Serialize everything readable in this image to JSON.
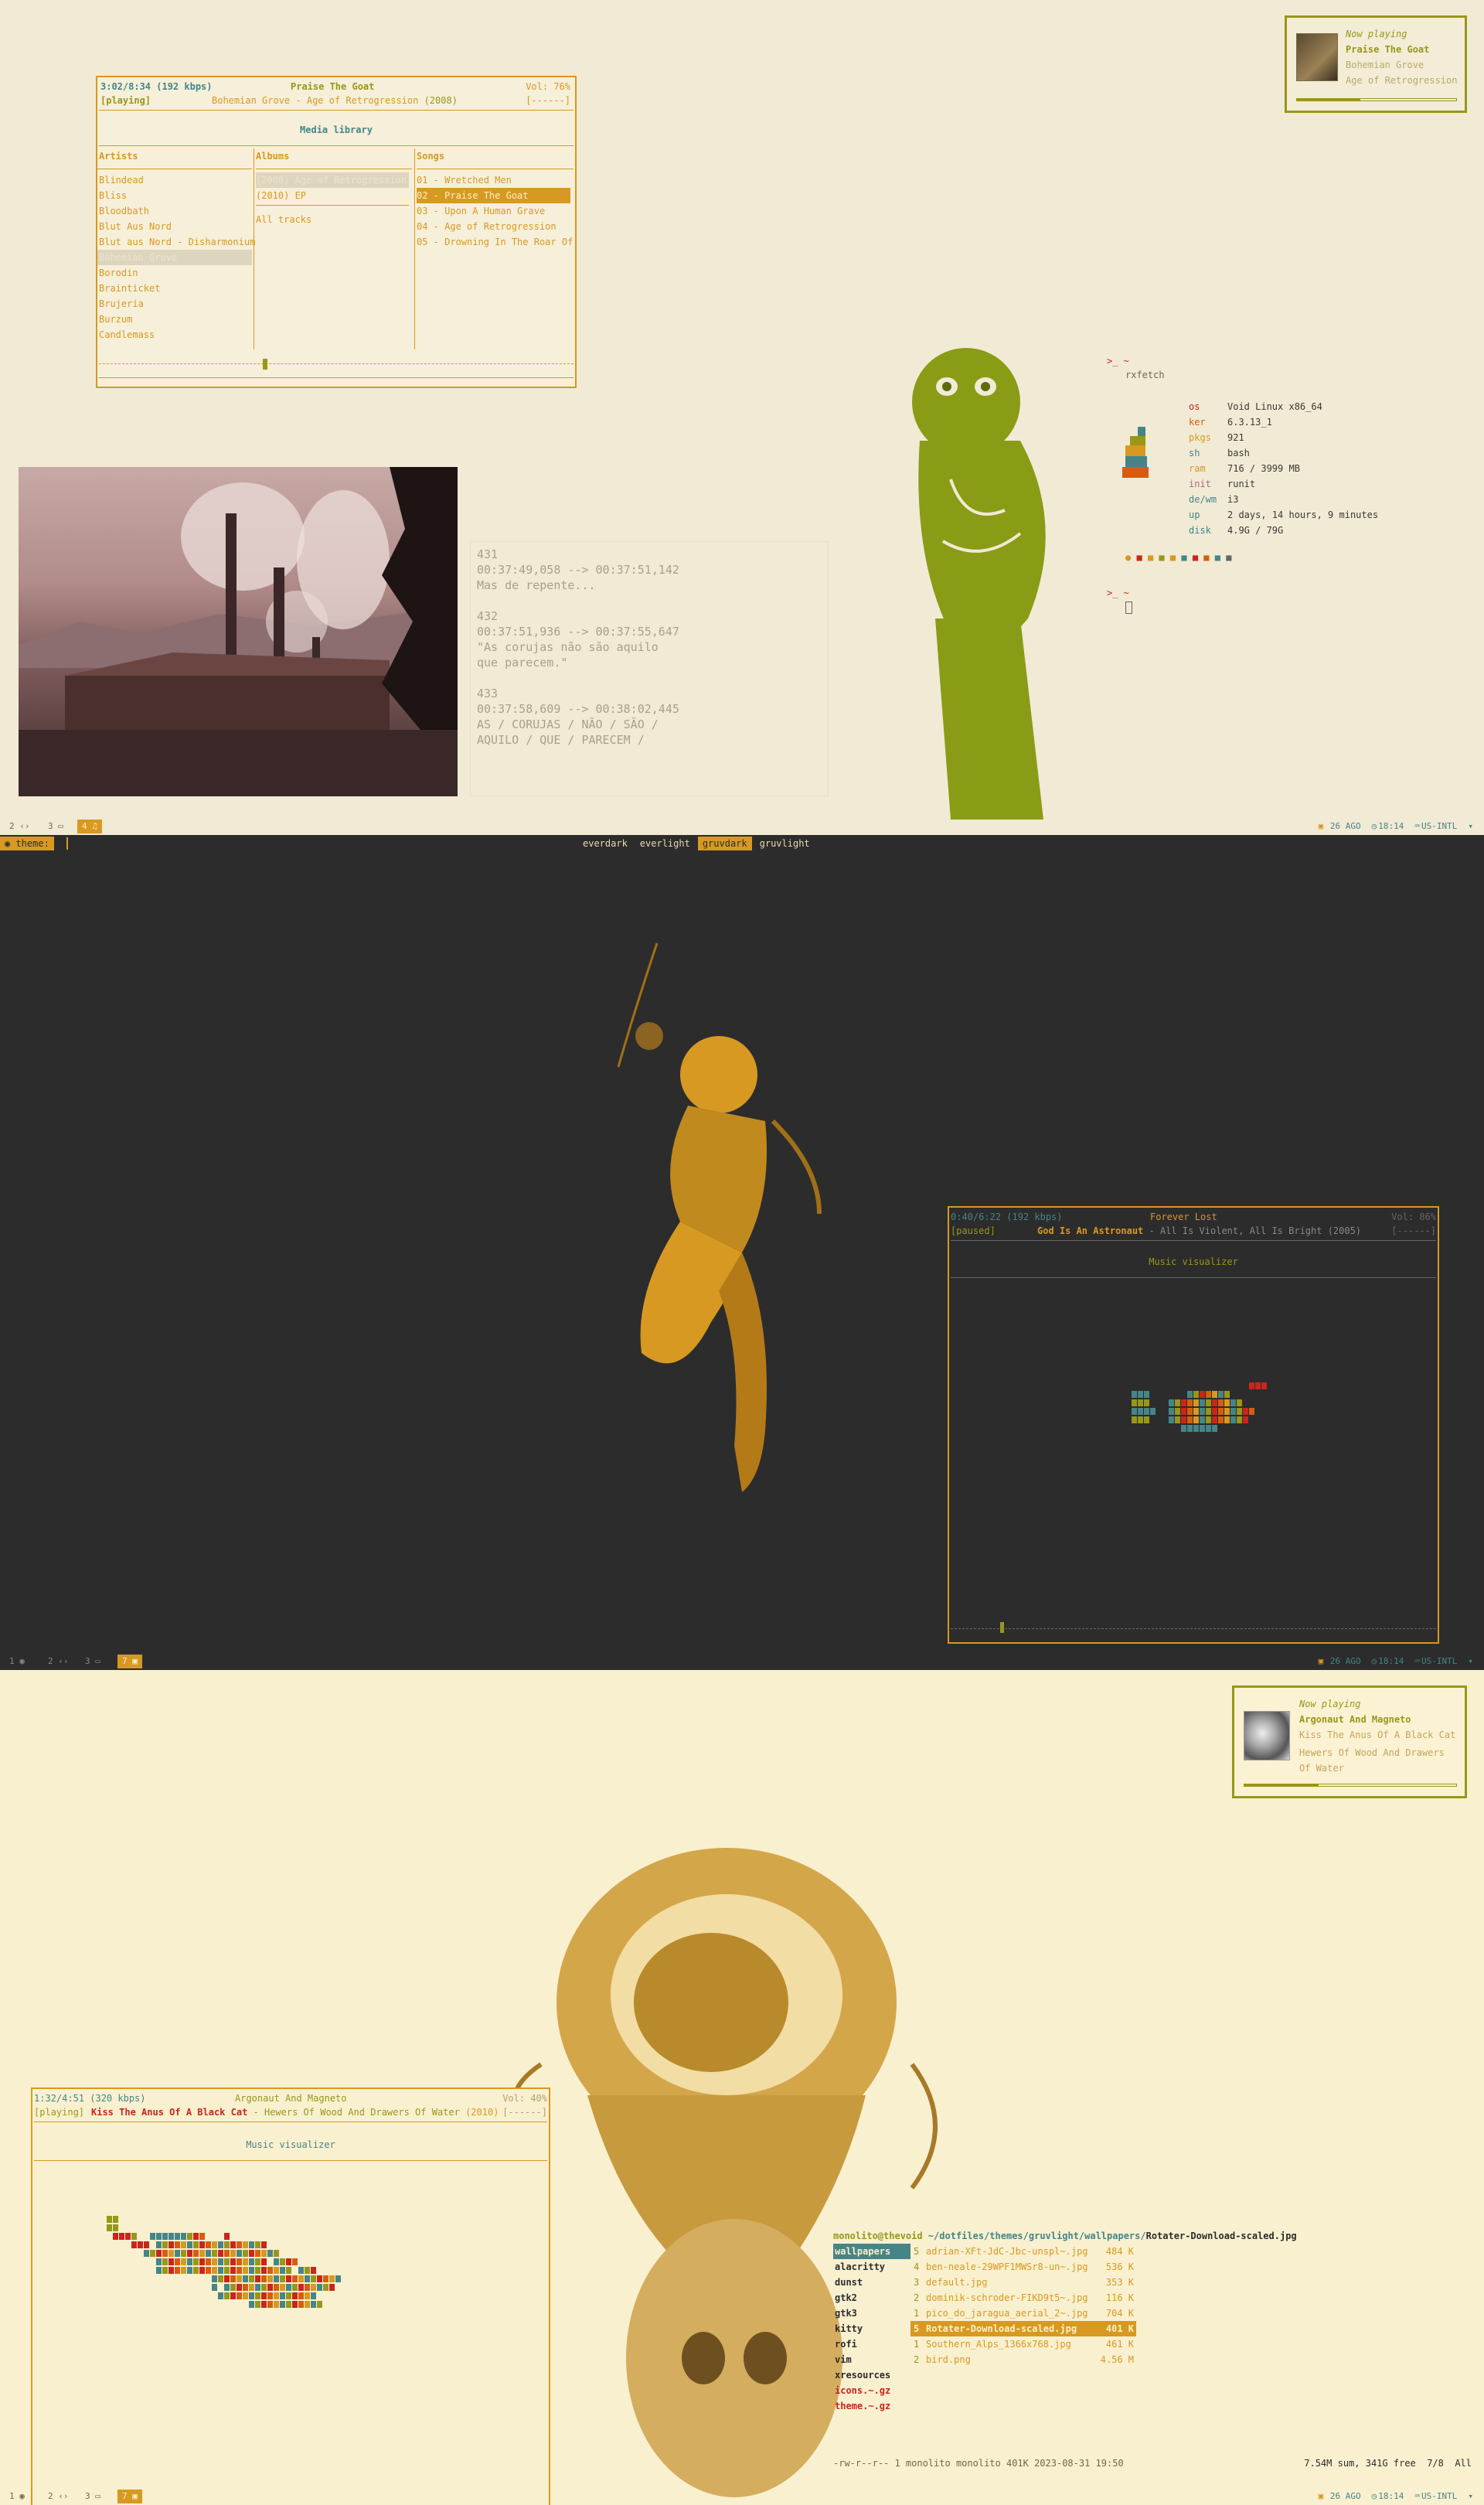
{
  "theme_bar": {
    "prompt": "theme:",
    "options": [
      "everdark",
      "everlight",
      "gruvdark",
      "gruvlight"
    ],
    "selected": "gruvdark"
  },
  "s1": {
    "player": {
      "time": "3:02/8:34 (192 kbps)",
      "track": "Praise The Goat",
      "vol": "Vol: 76%",
      "status": "[playing]",
      "artist": "Bohemian Grove",
      "sep": " - ",
      "album": "Age of Retrogression",
      "year": " (2008)",
      "flags": "[------]",
      "title": "Media library",
      "col_artists": "Artists",
      "col_albums": "Albums",
      "col_songs": "Songs",
      "artists": [
        "Blindead",
        "Bliss",
        "Bloodbath",
        "Blut Aus Nord",
        "Blut aus Nord - Disharmonium",
        "Bohemian Grove",
        "Borodin",
        "Brainticket",
        "Brujeria",
        "Burzum",
        "Candlemass"
      ],
      "albums": [
        "(2008) Age of Retrogression",
        "(2010) EP",
        "All tracks"
      ],
      "songs": [
        "01 - Wretched Men",
        "02 - Praise The Goat",
        "03 - Upon A Human Grave",
        "04 - Age of Retrogression",
        "05 - Drowning In The Roar Of"
      ],
      "selected_artist": "Bohemian Grove",
      "selected_song": "02 - Praise The Goat"
    },
    "notif": {
      "label": "Now playing",
      "track": "Praise The Goat",
      "artist": "Bohemian Grove",
      "album": "Age of Retrogression",
      "progress": 0.4
    },
    "subs": [
      {
        "n": "431",
        "t": "00:37:49,058 --> 00:37:51,142",
        "l": [
          "Mas de repente..."
        ]
      },
      {
        "n": "432",
        "t": "00:37:51,936 --> 00:37:55,647",
        "l": [
          "\"As corujas não são aquilo",
          "que parecem.\""
        ]
      },
      {
        "n": "433",
        "t": "00:37:58,609 --> 00:38:02,445",
        "l": [
          "AS / CORUJAS / NÃO / SÃO /",
          "AQUILO / QUE / PARECEM /"
        ]
      }
    ],
    "fetch": {
      "prompt": ">_ ~",
      "cmd": "rxfetch",
      "keys": [
        "os",
        "ker",
        "pkgs",
        "sh",
        "ram",
        "init",
        "de/wm",
        "up",
        "disk"
      ],
      "vals": [
        "Void Linux x86_64",
        "6.3.13_1",
        "921",
        "bash",
        "716 / 3999 MB",
        "runit",
        "i3",
        "2 days, 14 hours, 9 minutes",
        "4.9G / 79G"
      ]
    },
    "bar": {
      "ws": [
        "2",
        "3",
        "4"
      ],
      "active": "4",
      "date": "26 AGO",
      "time": "18:14",
      "kb": "US-INTL"
    }
  },
  "s2": {
    "player": {
      "time": "0:40/6:22 (192 kbps)",
      "track": "Forever Lost",
      "vol": "Vol: 86%",
      "status": "[paused]",
      "artist": "God Is An Astronaut",
      "sep": " - ",
      "album": "All Is Violent, All Is Bright",
      "year": " (2005)",
      "flags": "[------]",
      "title": "Music visualizer"
    },
    "bar": {
      "ws": [
        "1",
        "2",
        "3",
        "7"
      ],
      "active": "7",
      "date": "26 AGO",
      "time": "18:14",
      "kb": "US-INTL"
    }
  },
  "s3": {
    "notif": {
      "label": "Now playing",
      "track": "Argonaut And Magneto",
      "artist": "Kiss The Anus Of A Black Cat",
      "album": "Hewers Of Wood And Drawers Of Water",
      "progress": 0.35
    },
    "player": {
      "time": "1:32/4:51 (320 kbps)",
      "track": "Argonaut And Magneto",
      "vol": "Vol: 40%",
      "status": "[playing]",
      "artist": "Kiss The Anus Of A Black Cat",
      "sep": " - ",
      "album": "Hewers Of Wood And Drawers Of Water",
      "year": " (2010)",
      "flags": "[------]",
      "title": "Music visualizer"
    },
    "fm": {
      "user": "monolito@thevoid",
      "path": "~/dotfiles/themes/gruvlight/wallpapers/",
      "file": "Rotater-Download-scaled.jpg",
      "dirs": [
        "wallpapers",
        "alacritty",
        "dunst",
        "gtk2",
        "gtk3",
        "kitty",
        "rofi",
        "vim",
        "xresources",
        "icons.~.gz",
        "theme.~.gz"
      ],
      "nums": [
        "5",
        "4",
        "3",
        "2",
        "1",
        "5",
        "1",
        "2"
      ],
      "files": [
        "adrian-XFt-JdC-Jbc-unspl~.jpg",
        "ben-neale-29WPF1MWSr8-un~.jpg",
        "default.jpg",
        "dominik-schroder-FIKD9t5~.jpg",
        "pico_do_jaragua_aerial_2~.jpg",
        "Rotater-Download-scaled.jpg",
        "Southern_Alps_1366x768.jpg",
        "bird.png"
      ],
      "sizes": [
        "484 K",
        "536 K",
        "353 K",
        "116 K",
        "704 K",
        "401 K",
        "461 K",
        "4.56 M"
      ],
      "status": "-rw-r--r-- 1 monolito monolito 401K 2023-08-31 19:50",
      "summary": "7.54M sum, 341G free  7/8  All"
    },
    "bar": {
      "ws": [
        "1",
        "2",
        "3",
        "7"
      ],
      "active": "7",
      "date": "26 AGO",
      "time": "18:14",
      "kb": "US-INTL"
    }
  },
  "colors": {
    "accent": "#d79921",
    "green": "#98971a",
    "teal": "#458588",
    "red": "#cc241d",
    "orange": "#d65d0e",
    "dark": "#2c2c2c"
  }
}
